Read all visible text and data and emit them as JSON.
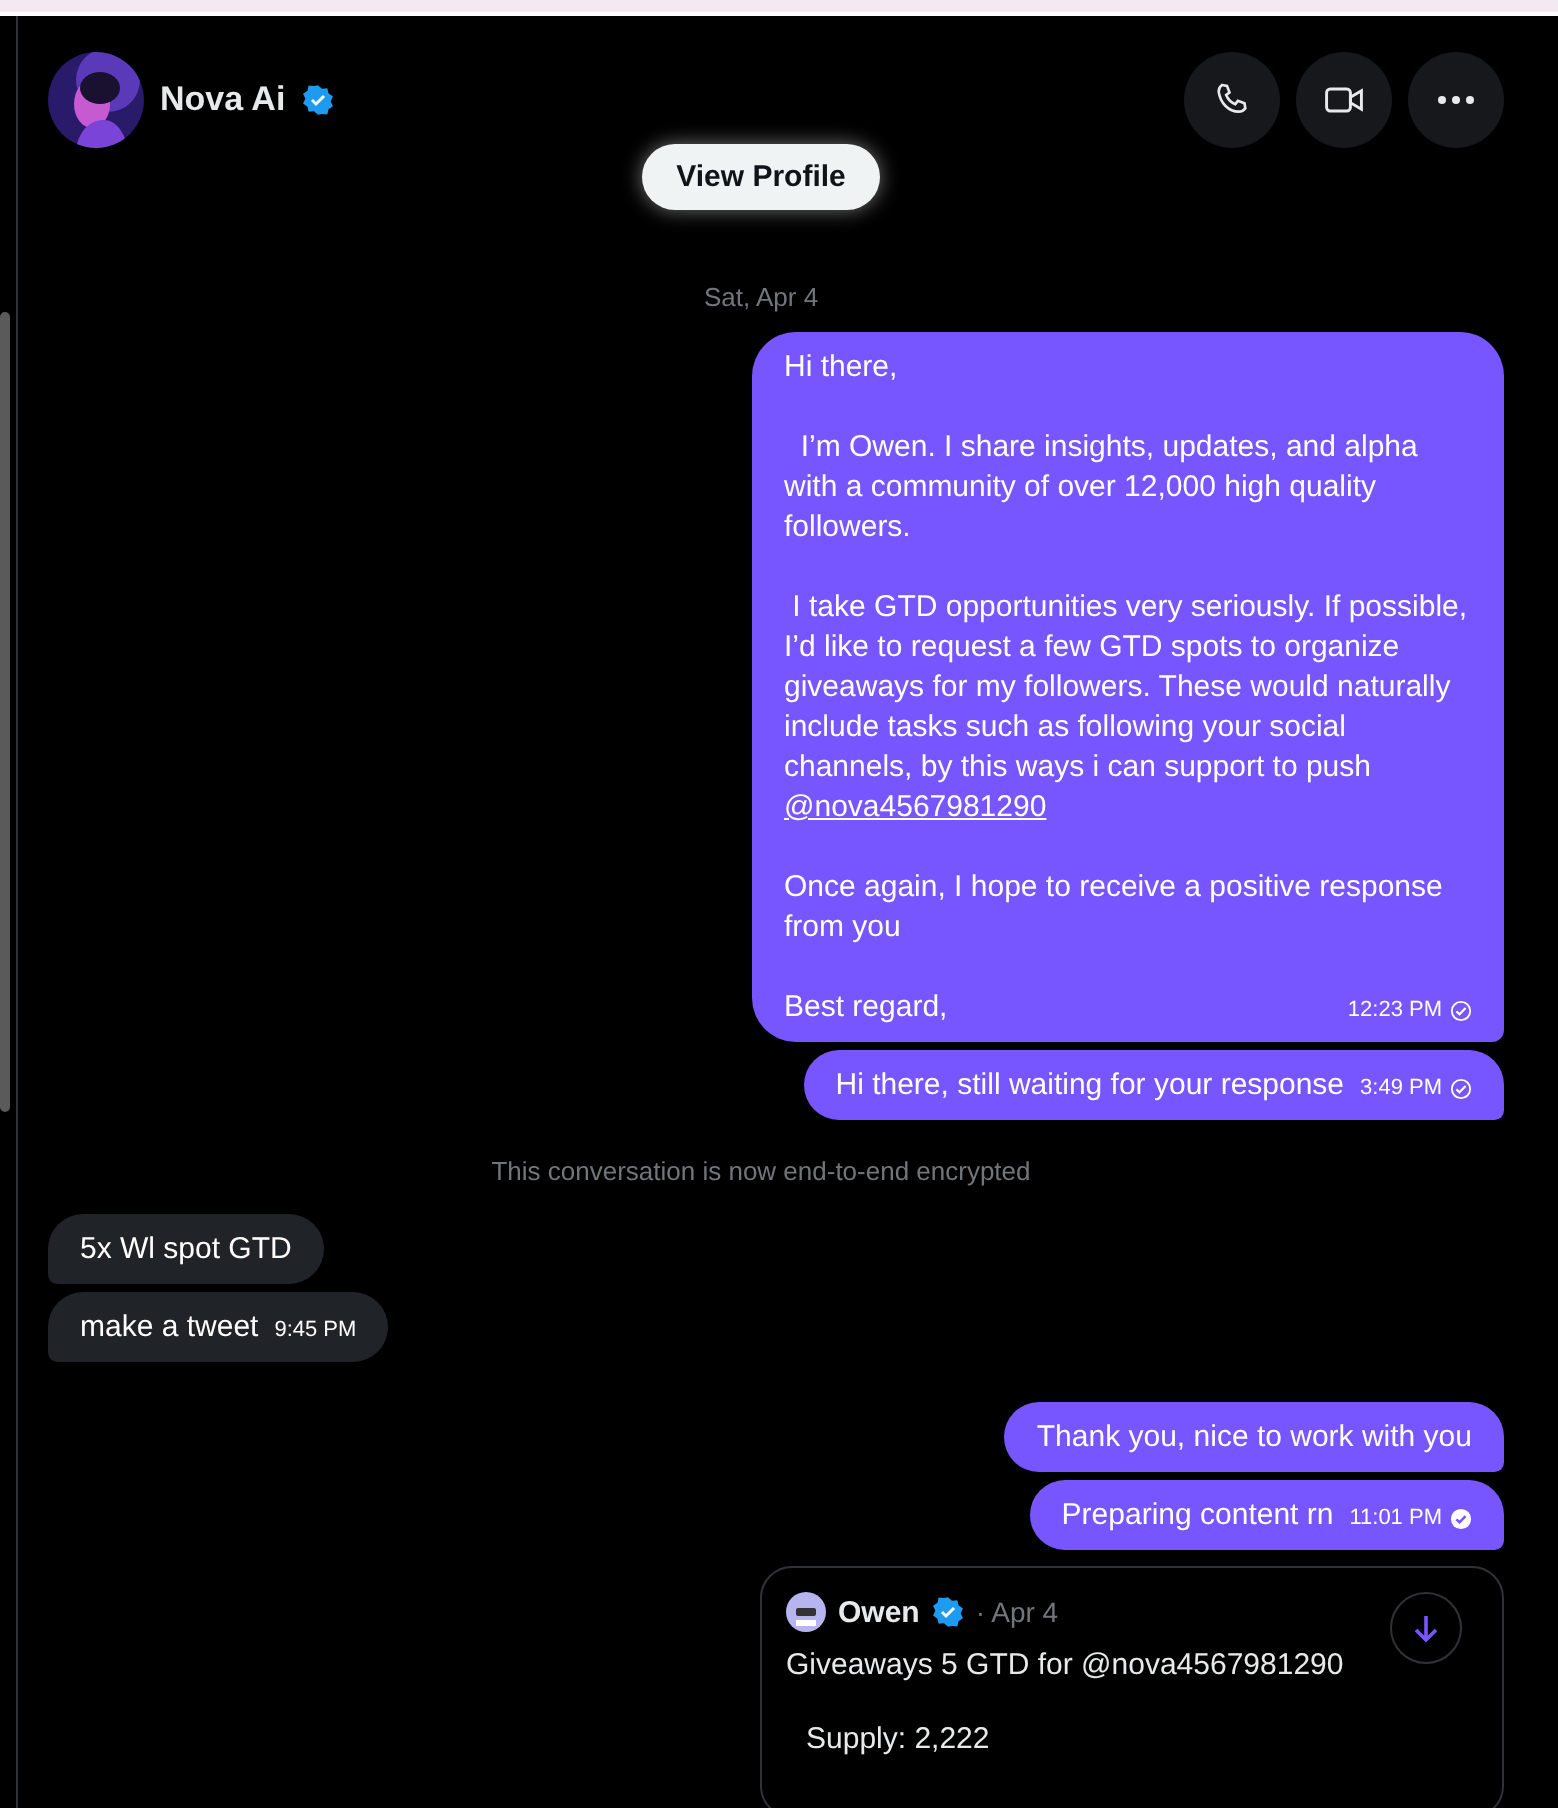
{
  "header": {
    "name": "Nova Ai",
    "verified": true,
    "view_profile": "View Profile"
  },
  "date_divider": "Sat, Apr 4",
  "messages": [
    {
      "kind": "sent",
      "text": "Hi there,\n\n  I’m Owen. I share insights, updates, and alpha with a community of over 12,000 high quality followers.\n\n I take GTD opportunities very seriously. If possible, I’d like to request a few GTD spots to organize giveaways for my followers. These would naturally include tasks such as following your social channels, by this ways i can support to push ",
      "mention": "@nova4567981290",
      "text_after": "\n\nOnce again, I hope to receive a positive response from you\n\nBest regard,",
      "time": "12:23 PM",
      "read": false
    },
    {
      "kind": "sent",
      "text": "Hi there, still waiting for your response",
      "time": "3:49 PM",
      "read": false
    },
    {
      "kind": "notice",
      "text": "This conversation is now end-to-end encrypted"
    },
    {
      "kind": "received",
      "text": "5x Wl spot GTD"
    },
    {
      "kind": "received",
      "text": "make a tweet",
      "time": "9:45 PM"
    },
    {
      "kind": "gap"
    },
    {
      "kind": "sent",
      "text": "Thank you, nice to work with you"
    },
    {
      "kind": "sent",
      "text": "Preparing content rn",
      "time": "11:01 PM",
      "read": true
    },
    {
      "kind": "tweet",
      "author": "Owen",
      "verified": true,
      "date": "· Apr 4",
      "text": "Giveaways 5 GTD for @nova4567981290",
      "detail": "Supply: 2,222"
    }
  ]
}
